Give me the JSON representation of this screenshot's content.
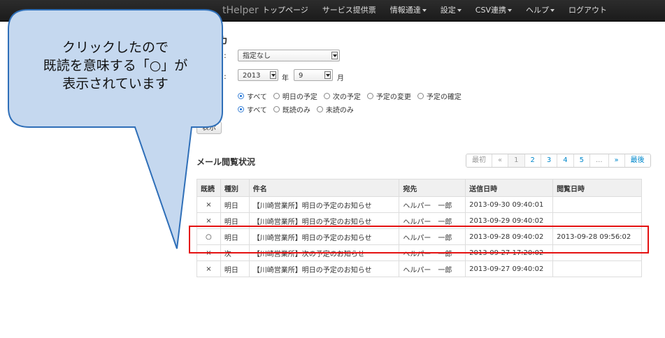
{
  "navbar": {
    "brand": "tHelper",
    "items": [
      {
        "label": "トップページ",
        "dropdown": false
      },
      {
        "label": "サービス提供票",
        "dropdown": false
      },
      {
        "label": "情報通達",
        "dropdown": true
      },
      {
        "label": "設定",
        "dropdown": true
      },
      {
        "label": "CSV連携",
        "dropdown": true
      },
      {
        "label": "ヘルプ",
        "dropdown": true
      },
      {
        "label": "ログアウト",
        "dropdown": false
      }
    ]
  },
  "form": {
    "heading": "カ",
    "colon1": ":",
    "colon2": ":",
    "target_select": "指定なし",
    "year_select": "2013",
    "year_unit": "年",
    "month_select": "9",
    "month_unit": "月",
    "type_options": [
      {
        "label": "すべて",
        "checked": true
      },
      {
        "label": "明日の予定",
        "checked": false
      },
      {
        "label": "次の予定",
        "checked": false
      },
      {
        "label": "予定の変更",
        "checked": false
      },
      {
        "label": "予定の確定",
        "checked": false
      }
    ],
    "read_options": [
      {
        "label": "すべて",
        "checked": true
      },
      {
        "label": "既読のみ",
        "checked": false
      },
      {
        "label": "未読のみ",
        "checked": false
      }
    ],
    "show_button": "表示"
  },
  "mail_status": {
    "title": "メール閲覧状況",
    "pagination": [
      {
        "label": "最初",
        "state": "disabled"
      },
      {
        "label": "«",
        "state": "disabled"
      },
      {
        "label": "1",
        "state": "active"
      },
      {
        "label": "2",
        "state": "normal"
      },
      {
        "label": "3",
        "state": "normal"
      },
      {
        "label": "4",
        "state": "normal"
      },
      {
        "label": "5",
        "state": "normal"
      },
      {
        "label": "...",
        "state": "disabled"
      },
      {
        "label": "»",
        "state": "normal"
      },
      {
        "label": "最後",
        "state": "normal"
      }
    ],
    "columns": [
      "既読",
      "種別",
      "件名",
      "宛先",
      "送信日時",
      "閲覧日時"
    ],
    "rows": [
      {
        "read": "×",
        "type": "明日",
        "subject": "【川崎営業所】明日の予定のお知らせ",
        "to": "ヘルパー　一郎",
        "sent": "2013-09-30 09:40:01",
        "viewed": ""
      },
      {
        "read": "×",
        "type": "明日",
        "subject": "【川崎営業所】明日の予定のお知らせ",
        "to": "ヘルパー　一郎",
        "sent": "2013-09-29 09:40:02",
        "viewed": ""
      },
      {
        "read": "○",
        "type": "明日",
        "subject": "【川崎営業所】明日の予定のお知らせ",
        "to": "ヘルパー　一郎",
        "sent": "2013-09-28 09:40:02",
        "viewed": "2013-09-28 09:56:02"
      },
      {
        "read": "×",
        "type": "次",
        "subject": "【川崎営業所】次の予定のお知らせ",
        "to": "ヘルパー　一郎",
        "sent": "2013-09-27 17:20:02",
        "viewed": ""
      },
      {
        "read": "×",
        "type": "明日",
        "subject": "【川崎営業所】明日の予定のお知らせ",
        "to": "ヘルパー　一郎",
        "sent": "2013-09-27 09:40:02",
        "viewed": ""
      }
    ]
  },
  "callout": {
    "lines": [
      "クリックしたので",
      "既読を意味する「○」が",
      "表示されています"
    ],
    "fill_color": "#c5d8ef",
    "stroke_color": "#2f6fb8"
  },
  "highlight_color": "#e41111"
}
